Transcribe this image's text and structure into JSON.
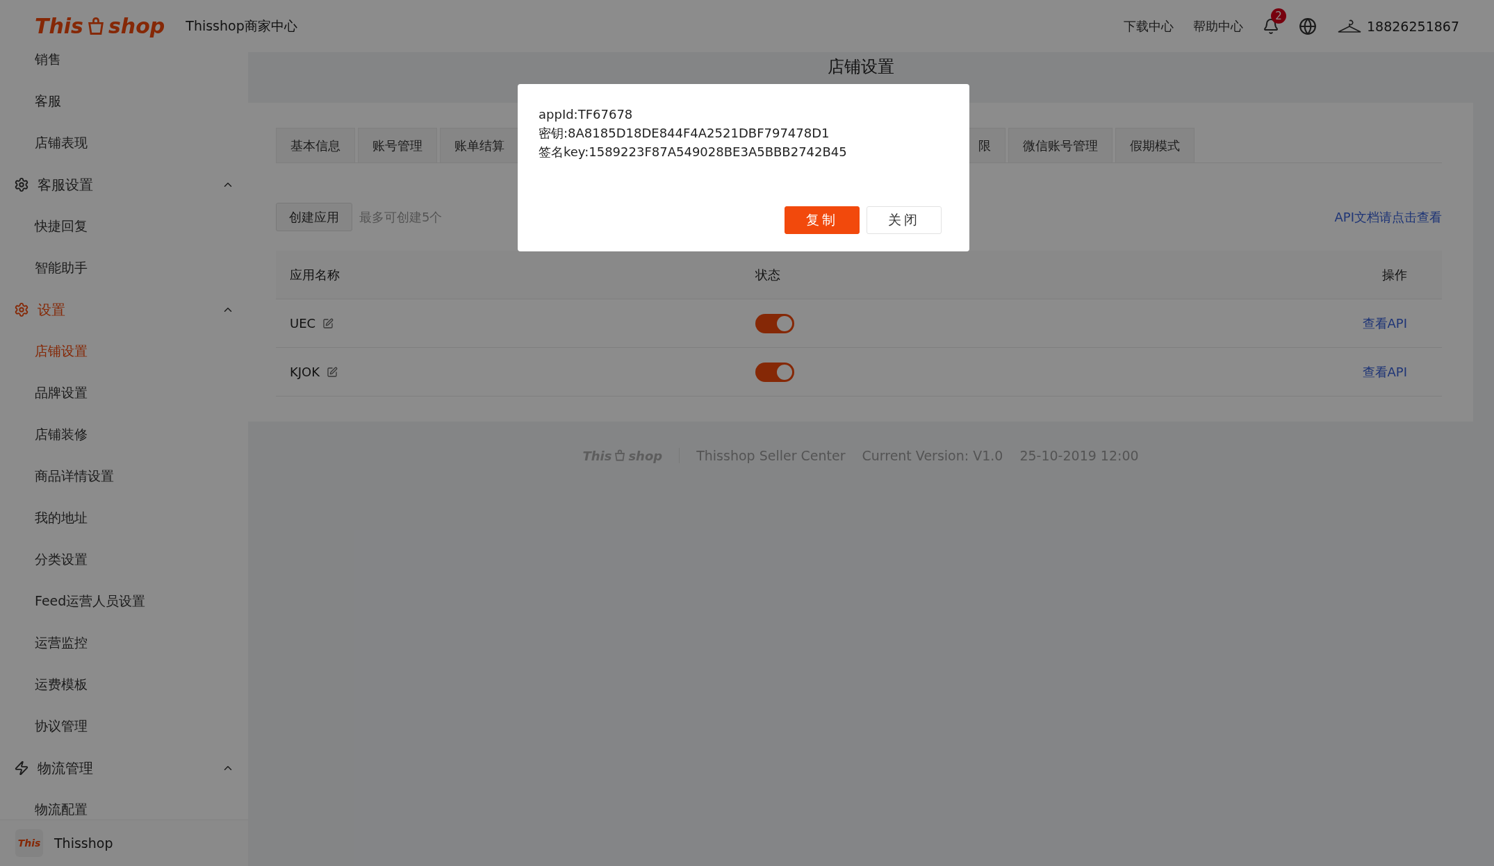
{
  "header": {
    "logo": {
      "left": "This",
      "right": "shop"
    },
    "title": "Thisshop商家中心",
    "links": [
      "下载中心",
      "帮助中心"
    ],
    "notifications": {
      "count": "2"
    },
    "account": "18826251867"
  },
  "sidebar": {
    "items": [
      {
        "kind": "item",
        "label": "销售",
        "selected": false
      },
      {
        "kind": "item",
        "label": "客服",
        "selected": false
      },
      {
        "kind": "item",
        "label": "店铺表现",
        "selected": false
      },
      {
        "kind": "group",
        "label": "客服设置",
        "expanded": true,
        "active": false
      },
      {
        "kind": "item",
        "label": "快捷回复",
        "selected": false
      },
      {
        "kind": "item",
        "label": "智能助手",
        "selected": false
      },
      {
        "kind": "group",
        "label": "设置",
        "expanded": true,
        "active": true
      },
      {
        "kind": "item",
        "label": "店铺设置",
        "selected": true
      },
      {
        "kind": "item",
        "label": "品牌设置",
        "selected": false
      },
      {
        "kind": "item",
        "label": "店铺装修",
        "selected": false
      },
      {
        "kind": "item",
        "label": "商品详情设置",
        "selected": false
      },
      {
        "kind": "item",
        "label": "我的地址",
        "selected": false
      },
      {
        "kind": "item",
        "label": "分类设置",
        "selected": false
      },
      {
        "kind": "item",
        "label": "Feed运营人员设置",
        "selected": false
      },
      {
        "kind": "item",
        "label": "运营监控",
        "selected": false
      },
      {
        "kind": "item",
        "label": "运费模板",
        "selected": false
      },
      {
        "kind": "item",
        "label": "协议管理",
        "selected": false
      },
      {
        "kind": "group",
        "label": "物流管理",
        "expanded": true,
        "active": false
      },
      {
        "kind": "item",
        "label": "物流配置",
        "selected": false
      }
    ],
    "footer": {
      "logo": "This",
      "name": "Thisshop"
    }
  },
  "page": {
    "title": "店铺设置",
    "tabs_left": [
      {
        "label": "基本信息",
        "selected": false
      },
      {
        "label": "账号管理",
        "selected": false
      },
      {
        "label": "账单结算",
        "selected": false
      }
    ],
    "tabs_right": [
      {
        "label": "限",
        "selected": false
      },
      {
        "label": "微信账号管理",
        "selected": false
      },
      {
        "label": "假期模式",
        "selected": false
      }
    ],
    "toolbar": {
      "create_button": "创建应用",
      "hint": "最多可创建5个",
      "doc_link": "API文档请点击查看"
    },
    "table": {
      "columns": [
        "应用名称",
        "状态",
        "操作"
      ],
      "rows": [
        {
          "name": "UEC",
          "on": true,
          "action": "查看API"
        },
        {
          "name": "KJOK",
          "on": true,
          "action": "查看API"
        }
      ]
    }
  },
  "footer": {
    "logo": {
      "left": "This",
      "right": "shop"
    },
    "product": "Thisshop Seller Center",
    "version": "Current Version: V1.0",
    "date": "25-10-2019 12:00"
  },
  "dialog": {
    "lines": [
      "appId:TF67678",
      "密钥:8A8185D18DE844F4A2521DBF797478D1",
      "签名key:1589223F87A549028BE3A5BBB2742B45"
    ],
    "buttons": [
      {
        "label": "复制",
        "kind": "primary"
      },
      {
        "label": "关闭",
        "kind": "default"
      }
    ]
  }
}
